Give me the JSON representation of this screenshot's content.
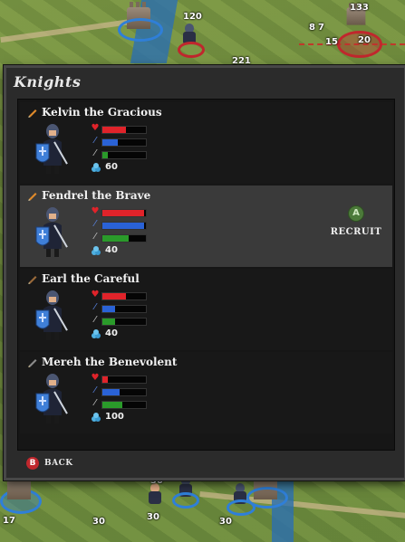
{
  "panel": {
    "title": "Knights",
    "back_label": "BACK",
    "back_button_glyph": "B"
  },
  "knights": [
    {
      "name": "Kelvin the Gracious",
      "pencil_color": "#e08a2a",
      "health": 0.55,
      "mana": 0.35,
      "attack": 0.12,
      "cost": "60",
      "selected": false,
      "shield_color": "#3f7fd8"
    },
    {
      "name": "Fendrel the Brave",
      "pencil_color": "#e08a2a",
      "health": 0.95,
      "mana": 0.95,
      "attack": 0.6,
      "cost": "40",
      "selected": true,
      "shield_color": "#3f7fd8",
      "action": {
        "button_glyph": "A",
        "label": "RECRUIT"
      }
    },
    {
      "name": "Earl the Careful",
      "pencil_color": "#9a6a3a",
      "health": 0.55,
      "mana": 0.3,
      "attack": 0.3,
      "cost": "40",
      "selected": false,
      "shield_color": "#3f7fd8"
    },
    {
      "name": "Mereh the Benevolent",
      "pencil_color": "#8a8a8a",
      "health": 0.12,
      "mana": 0.4,
      "attack": 0.45,
      "cost": "100",
      "selected": false,
      "shield_color": "#3f7fd8"
    }
  ],
  "stat_colors": {
    "health": "#e0232a",
    "mana": "#2a62d6",
    "attack": "#2a9a2a"
  },
  "map": {
    "labels": [
      "120",
      "221",
      "133",
      "8",
      "7",
      "15",
      "20",
      "30",
      "17",
      "30",
      "30",
      "30"
    ]
  }
}
